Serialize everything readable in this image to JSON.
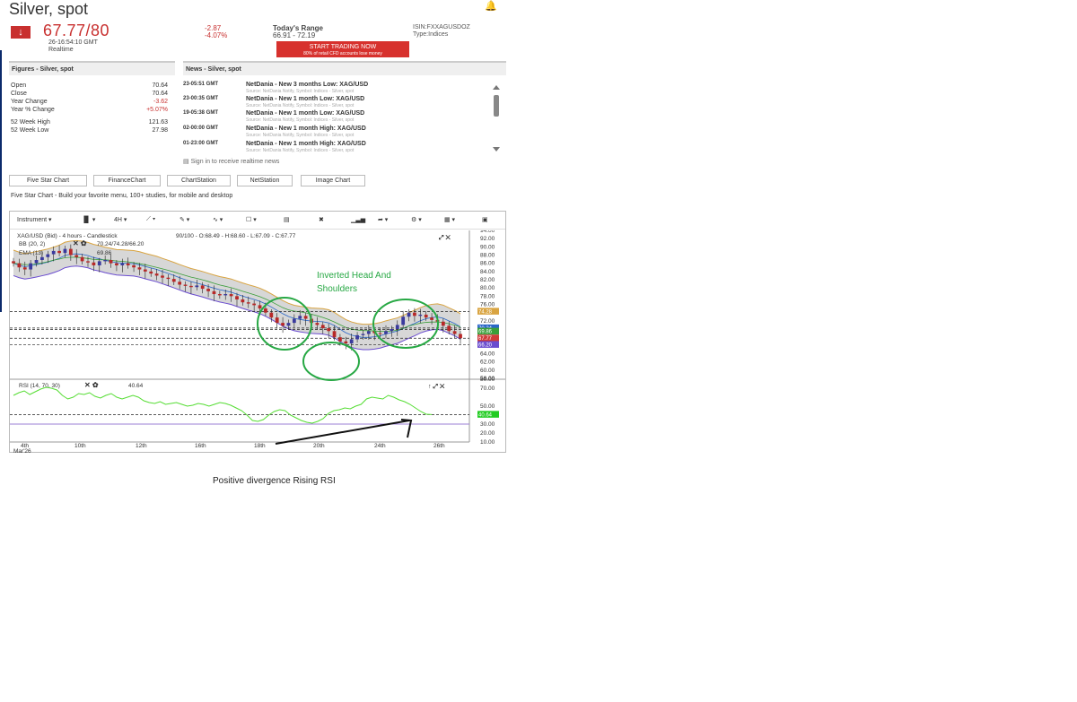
{
  "header": {
    "title": "Silver, spot",
    "price": "67.77/80",
    "price_time": "26-16:54:10 GMT",
    "realtime": "Realtime",
    "change_abs": "-2.87",
    "change_pct": "-4.07%",
    "range_label": "Today's Range",
    "range_value": "66.91 - 72.19",
    "isin": "ISIN:FXXAGUSDOZ",
    "type": "Type:Indices",
    "trade_button": "START TRADING NOW",
    "trade_sub": "80% of retail CFD accounts lose money",
    "colors": {
      "negative": "#c8302f",
      "cta": "#d7312d"
    }
  },
  "figures": {
    "heading": "Figures - Silver, spot",
    "rows": [
      {
        "label": "Open",
        "value": "70.64",
        "color": "#333333"
      },
      {
        "label": "Close",
        "value": "70.64",
        "color": "#333333"
      },
      {
        "label": "Year Change",
        "value": "-3.62",
        "color": "#c8302f"
      },
      {
        "label": "Year % Change",
        "value": "+5.07%",
        "color": "#c8302f"
      },
      {
        "label": "52 Week High",
        "value": "121.63",
        "color": "#333333"
      },
      {
        "label": "52 Week Low",
        "value": "27.98",
        "color": "#333333"
      }
    ]
  },
  "news": {
    "heading": "News - Silver, spot",
    "items": [
      {
        "time": "23-05:51 GMT",
        "headline": "NetDania - New 3 months Low: XAG/USD",
        "source": "Source: NetDania Notify, Symbol: Indices - Silver, spot"
      },
      {
        "time": "23-00:35 GMT",
        "headline": "NetDania - New 1 month Low: XAG/USD",
        "source": "Source: NetDania Notify, Symbol: Indices - Silver, spot"
      },
      {
        "time": "19-05:38 GMT",
        "headline": "NetDania - New 1 month Low: XAG/USD",
        "source": "Source: NetDania Notify, Symbol: Indices - Silver, spot"
      },
      {
        "time": "02-00:00 GMT",
        "headline": "NetDania - New 1 month High: XAG/USD",
        "source": "Source: NetDania Notify, Symbol: Indices - Silver, spot"
      },
      {
        "time": "01-23:00 GMT",
        "headline": "NetDania - New 1 month High: XAG/USD",
        "source": "Source: NetDania Notify, Symbol: Indices - Silver, spot"
      }
    ],
    "signin": "Sign in to receive realtime news"
  },
  "tabs": [
    "Five Star Chart",
    "FinanceChart",
    "ChartStation",
    "NetStation",
    "Image Chart"
  ],
  "fsc_description": "Five Star Chart - Build your favorite menu, 100+ studies, for mobile and desktop",
  "toolbar": {
    "instrument": "Instrument",
    "interval": "4H"
  },
  "chart_data": {
    "type": "candlestick",
    "symbol_line": "XAG/USD (Bid) - 4 hours - Candlestick",
    "ohlc_line": "90/100 - O:68.49 - H:68.60 - L:67.09 - C:67.77",
    "bb_label": "BB (20, 2)",
    "bb_values": "70.24/74.28/66.20",
    "ema_label": "EMA (13)",
    "ema_value": "69.86",
    "rsi_label": "RSI (14, 70, 30)",
    "rsi_value": "40.64",
    "price_axis": [
      "94.00",
      "92.00",
      "90.00",
      "88.00",
      "86.00",
      "84.00",
      "82.00",
      "80.00",
      "78.00",
      "76.00",
      "74.00",
      "72.00",
      "70.00",
      "68.00",
      "66.00",
      "64.00",
      "62.00",
      "60.00",
      "58.00"
    ],
    "rsi_axis": [
      "80.00",
      "70.00",
      "50.00",
      "40.00",
      "30.00",
      "20.00",
      "10.00"
    ],
    "x_labels": [
      "4th",
      "10th",
      "12th",
      "16th",
      "18th",
      "20th",
      "24th",
      "26th"
    ],
    "x_sub": "Mar'26",
    "price_tags": [
      {
        "value": "74.28",
        "bg": "#d9a441"
      },
      {
        "value": "70.24",
        "bg": "#2a66c8"
      },
      {
        "value": "69.86",
        "bg": "#3a9e3a"
      },
      {
        "value": "67.77",
        "bg": "#d03a3a"
      },
      {
        "value": "66.20",
        "bg": "#6a4ccf"
      }
    ],
    "rsi_tag": {
      "value": "40.64",
      "bg": "#22cc22"
    },
    "price_range": [
      58,
      94
    ],
    "closes": [
      86,
      85,
      84.5,
      86,
      86.8,
      87.5,
      88.2,
      89,
      88.5,
      89.5,
      88,
      87.5,
      86.5,
      86.2,
      85.5,
      86.5,
      86.8,
      86,
      85.5,
      86,
      85.5,
      85,
      84.5,
      84,
      83.5,
      83,
      82.5,
      82.2,
      81.5,
      80.8,
      80.5,
      80.2,
      80.6,
      79.8,
      79.2,
      78.5,
      78.2,
      78.5,
      78,
      77.2,
      76.5,
      76.2,
      75.8,
      75,
      74,
      72.8,
      71.5,
      70.8,
      71.5,
      72.5,
      73.2,
      72.5,
      71.5,
      71,
      70.2,
      69.5,
      68,
      67,
      66.5,
      67.5,
      68.5,
      68.8,
      69.5,
      69,
      68.8,
      69.5,
      70,
      71,
      73,
      74,
      73.2,
      73.5,
      72.8,
      72.2,
      71.8,
      70.8,
      69.5,
      68.8,
      67.77
    ],
    "rsi_values": [
      62,
      65,
      67,
      63,
      66,
      69,
      71,
      70,
      68,
      62,
      58,
      60,
      64,
      63,
      65,
      61,
      59,
      62,
      64,
      60,
      58,
      60,
      62,
      60,
      56,
      54,
      53,
      55,
      52,
      53,
      54,
      52,
      50,
      51,
      53,
      52,
      50,
      52,
      54,
      53,
      51,
      48,
      45,
      40,
      34,
      33,
      35,
      40,
      44,
      46,
      45,
      40,
      37,
      34,
      32,
      31,
      33,
      36,
      42,
      45,
      46,
      48,
      47,
      50,
      52,
      58,
      60,
      59,
      58,
      62,
      60,
      57,
      55,
      52,
      48,
      44,
      41,
      40.64
    ],
    "rsi_range": [
      10,
      80
    ]
  },
  "annotations": {
    "pattern_label_1": "Inverted Head And",
    "pattern_label_2": "Shoulders",
    "caption": "Positive divergence Rising RSI"
  }
}
